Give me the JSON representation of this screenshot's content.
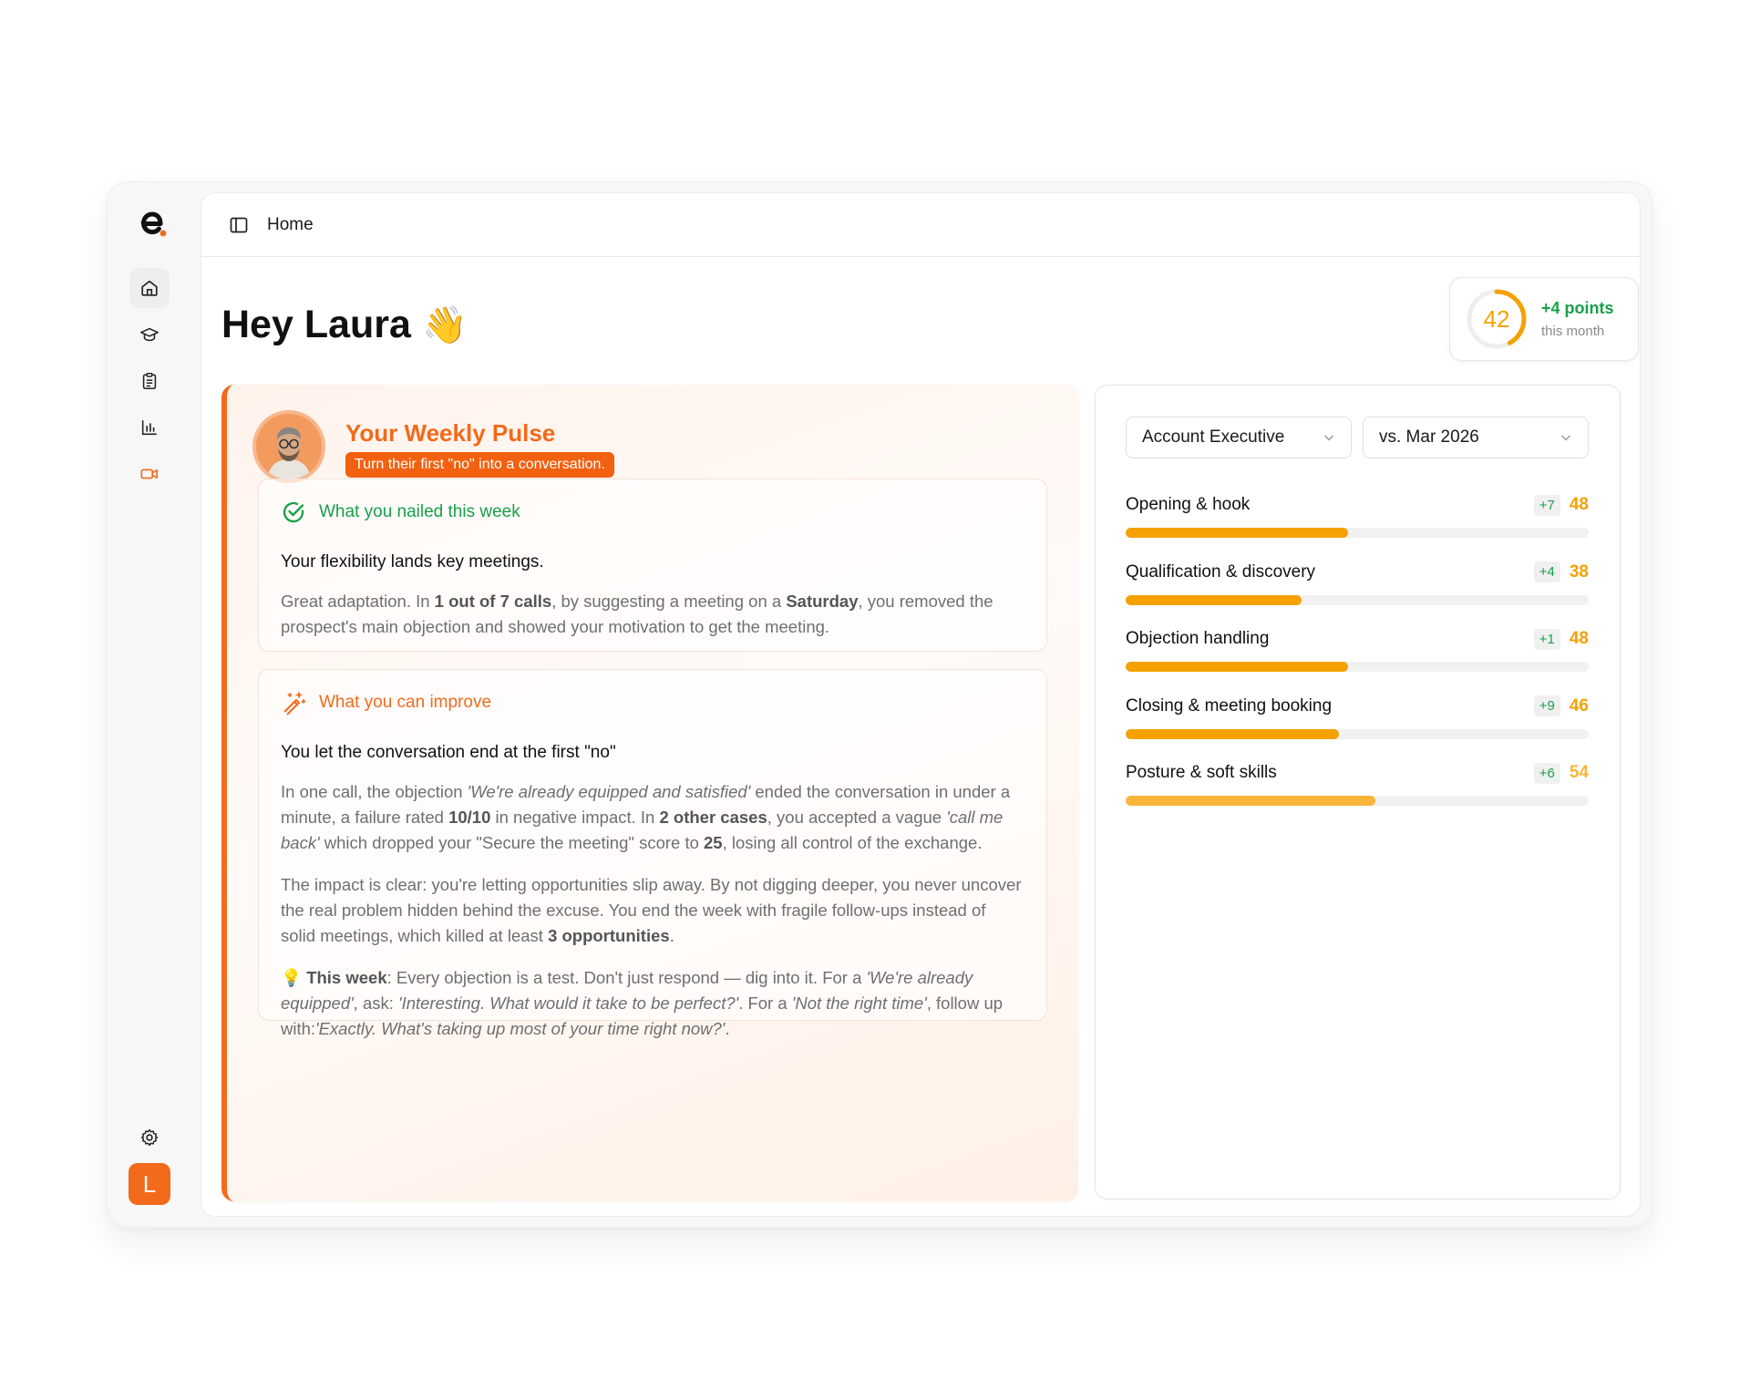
{
  "nav": {
    "items": [
      {
        "name": "home",
        "icon": "home-icon",
        "active": true
      },
      {
        "name": "learning",
        "icon": "graduation-cap-icon",
        "active": false
      },
      {
        "name": "tasks",
        "icon": "clipboard-icon",
        "active": false
      },
      {
        "name": "analytics",
        "icon": "bar-chart-icon",
        "active": false
      },
      {
        "name": "calls",
        "icon": "video-camera-icon",
        "active": false
      }
    ],
    "settings_icon": "gear-icon",
    "user_initial": "L"
  },
  "topbar": {
    "breadcrumb": "Home"
  },
  "greeting": {
    "text": "Hey Laura",
    "emoji": "👋"
  },
  "score": {
    "value": "42",
    "level": 0.42,
    "delta": "+4 points",
    "period": "this month"
  },
  "pulse": {
    "title": "Your Weekly Pulse",
    "tagline": "Turn their first \"no\" into a conversation.",
    "nailed": {
      "heading": "What you nailed this week",
      "title": "Your flexibility lands key meetings.",
      "body_html": "Great adaptation. In <b>1 out of 7 calls</b>, by suggesting a meeting on a <b>Saturday</b>, you removed the prospect's main objection and showed your motivation to get the meeting."
    },
    "improve": {
      "heading": "What you can improve",
      "title": "You let the conversation end at the first \"no\"",
      "p1_html": "In one call, the objection <i>'We're already equipped and satisfied'</i> ended the conversation in under a minute, a failure rated <b>10/10</b> in negative impact. In <b>2 other cases</b>, you accepted a vague <i>'call me back'</i> which dropped your \"Secure the meeting\" score to <b>25</b>, losing all control of the exchange.",
      "p2_html": "The impact is clear: you're letting opportunities slip away. By not digging deeper, you never uncover the real problem hidden behind the excuse. You end the week with fragile follow-ups instead of solid meetings, which killed at least <b>3 opportunities</b>.",
      "p3_html": "💡 <b>This week</b>: Every objection is a test. Don't just respond — dig into it. For a <i>'We're already equipped'</i>, ask: <i>'Interesting. What would it take to be perfect?'</i>. For a <i>'Not the right time'</i>, follow up with:<i>'Exactly. What's taking up most of your time right now?'</i>."
    }
  },
  "filters": {
    "role": "Account Executive",
    "compare": "vs. Mar 2026"
  },
  "skills": [
    {
      "name": "Opening & hook",
      "delta": "+7",
      "score": 48,
      "color": "#f5a100"
    },
    {
      "name": "Qualification & discovery",
      "delta": "+4",
      "score": 38,
      "color": "#f5a100"
    },
    {
      "name": "Objection handling",
      "delta": "+1",
      "score": 48,
      "color": "#f5a100"
    },
    {
      "name": "Closing & meeting booking",
      "delta": "+9",
      "score": 46,
      "color": "#f5a100"
    },
    {
      "name": "Posture & soft skills",
      "delta": "+6",
      "score": 54,
      "color": "#f9b43a"
    }
  ],
  "colors": {
    "accent": "#f26a1b",
    "score": "#f5a100",
    "positive": "#18a048"
  }
}
